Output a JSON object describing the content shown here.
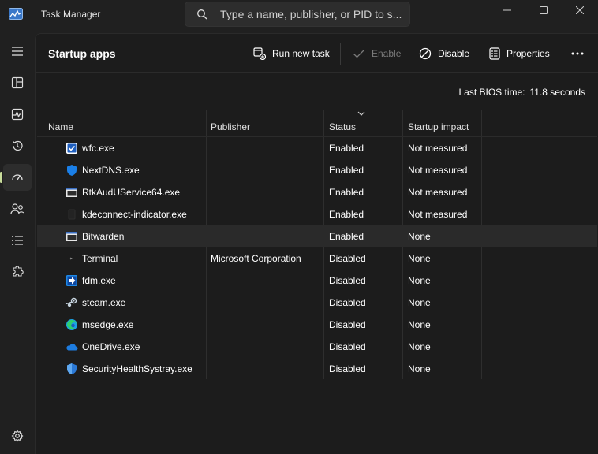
{
  "app": {
    "title": "Task Manager"
  },
  "search": {
    "placeholder": "Type a name, publisher, or PID to s..."
  },
  "page": {
    "title": "Startup apps"
  },
  "toolbar": {
    "run_new_task": "Run new task",
    "enable": "Enable",
    "disable": "Disable",
    "properties": "Properties"
  },
  "bios": {
    "label": "Last BIOS time:",
    "value": "11.8 seconds"
  },
  "columns": {
    "name": "Name",
    "publisher": "Publisher",
    "status": "Status",
    "impact": "Startup impact"
  },
  "rows": [
    {
      "name": "wfc.exe",
      "publisher": "",
      "status": "Enabled",
      "impact": "Not measured",
      "icon": "checkbox-app-icon"
    },
    {
      "name": "NextDNS.exe",
      "publisher": "",
      "status": "Enabled",
      "impact": "Not measured",
      "icon": "shield-app-icon"
    },
    {
      "name": "RtkAudUService64.exe",
      "publisher": "",
      "status": "Enabled",
      "impact": "Not measured",
      "icon": "window-app-icon"
    },
    {
      "name": "kdeconnect-indicator.exe",
      "publisher": "",
      "status": "Enabled",
      "impact": "Not measured",
      "icon": "blank-app-icon"
    },
    {
      "name": "Bitwarden",
      "publisher": "",
      "status": "Enabled",
      "impact": "None",
      "icon": "window-app-icon"
    },
    {
      "name": "Terminal",
      "publisher": "Microsoft Corporation",
      "status": "Disabled",
      "impact": "None",
      "icon": "terminal-app-icon"
    },
    {
      "name": "fdm.exe",
      "publisher": "",
      "status": "Disabled",
      "impact": "None",
      "icon": "fdm-app-icon"
    },
    {
      "name": "steam.exe",
      "publisher": "",
      "status": "Disabled",
      "impact": "None",
      "icon": "steam-app-icon"
    },
    {
      "name": "msedge.exe",
      "publisher": "",
      "status": "Disabled",
      "impact": "None",
      "icon": "edge-app-icon"
    },
    {
      "name": "OneDrive.exe",
      "publisher": "",
      "status": "Disabled",
      "impact": "None",
      "icon": "cloud-app-icon"
    },
    {
      "name": "SecurityHealthSystray.exe",
      "publisher": "",
      "status": "Disabled",
      "impact": "None",
      "icon": "security-shield-app-icon"
    }
  ],
  "colors": {
    "accent": "#c9dd9b",
    "background": "#202020",
    "surface": "#1c1c1c",
    "highlight_row": "#2a2a2a"
  }
}
